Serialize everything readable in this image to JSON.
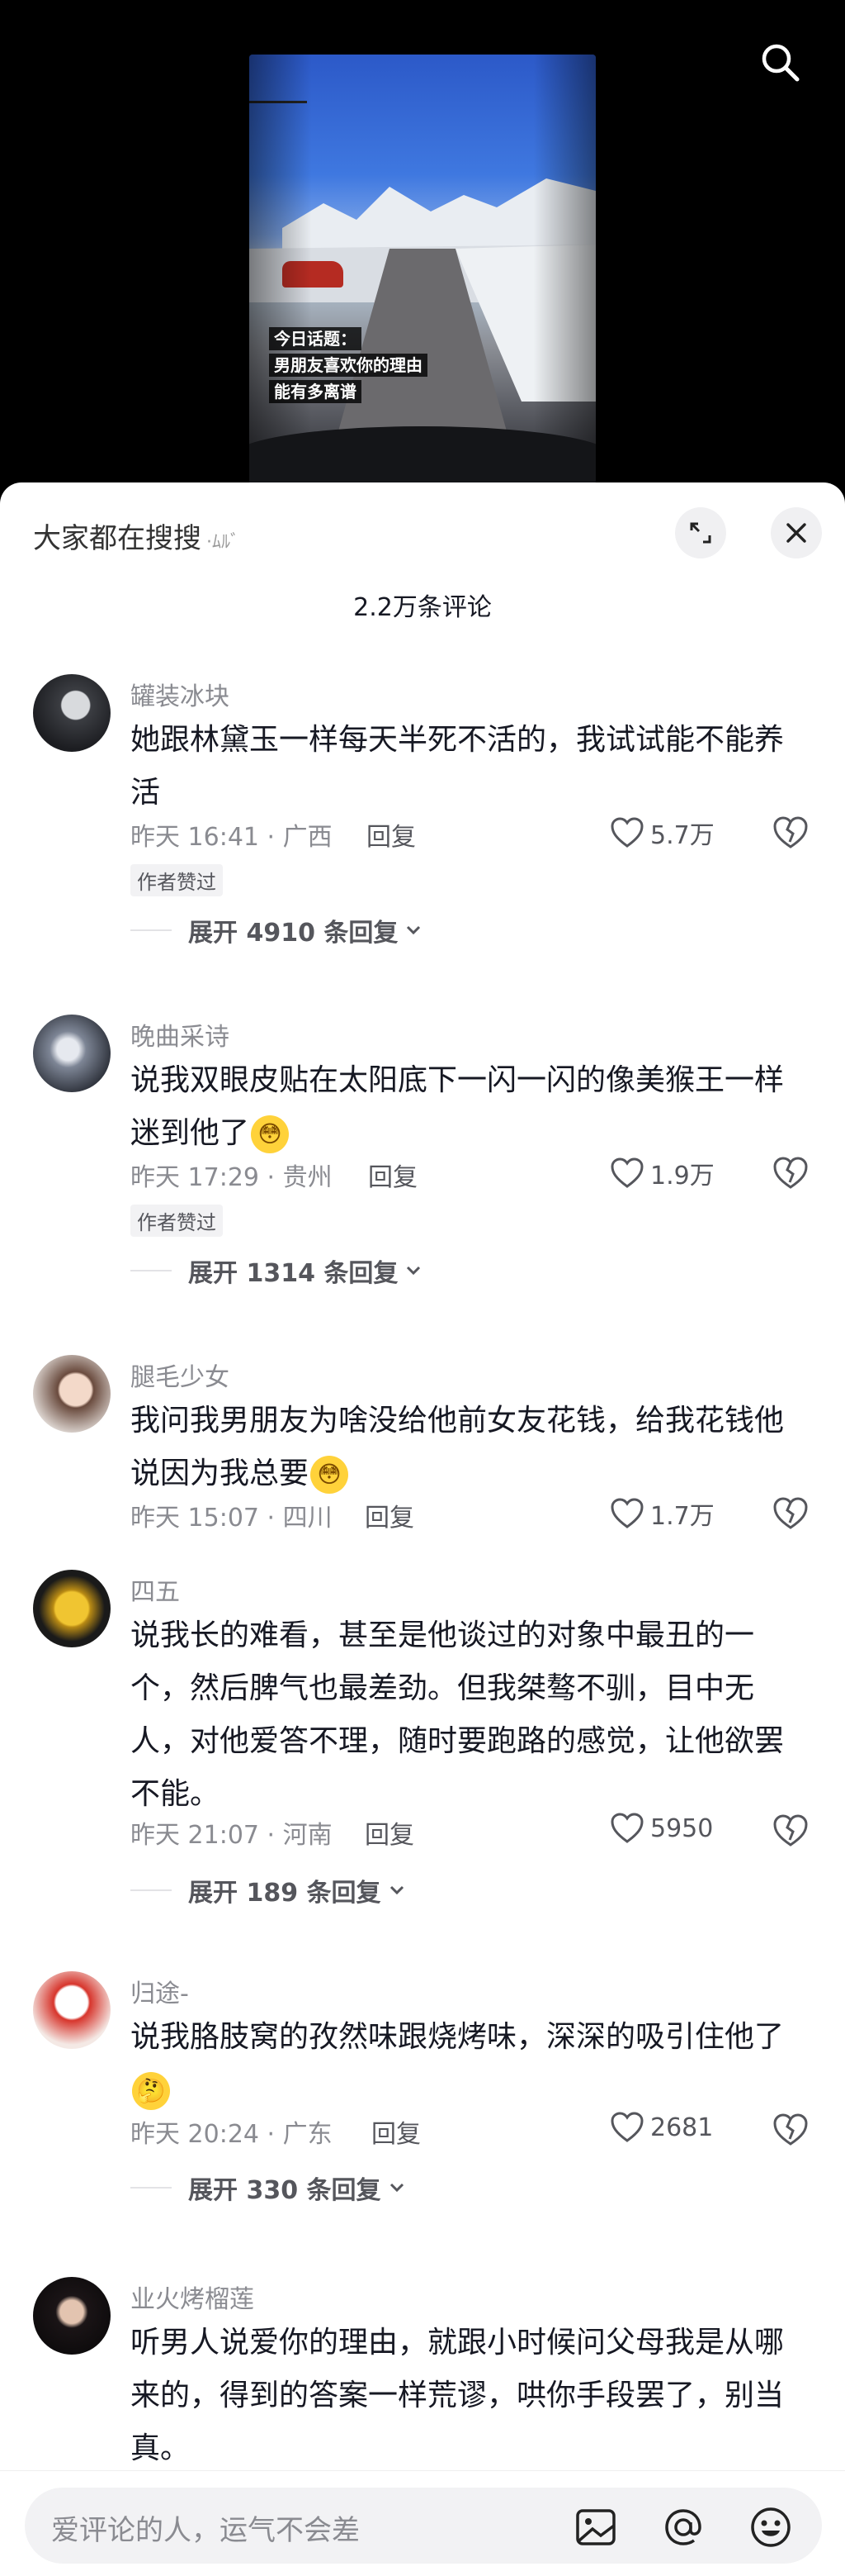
{
  "video": {
    "topic_lines": [
      "今日话题：",
      "男朋友喜欢你的理由",
      "能有多离谱"
    ]
  },
  "sheet": {
    "title": "大家都在搜搜",
    "title_suffix": "·ﾑﾙﾞ",
    "comment_count": "2.2万条评论"
  },
  "comments": [
    {
      "username": "罐装冰块",
      "text": "她跟林黛玉一样每天半死不活的，我试试能不能养活",
      "time_location": "昨天 16:41 · 广西",
      "reply_label": "回复",
      "likes": "5.7万",
      "author_tag": "作者赞过",
      "expand_label": "展开 4910 条回复"
    },
    {
      "username": "晚曲采诗",
      "text": "说我双眼皮贴在太阳底下一闪一闪的像美猴王一样迷到他了",
      "emoji": "😳",
      "time_location": "昨天 17:29 · 贵州",
      "reply_label": "回复",
      "likes": "1.9万",
      "author_tag": "作者赞过",
      "expand_label": "展开 1314 条回复"
    },
    {
      "username": "腿毛少女",
      "text": "我问我男朋友为啥没给他前女友花钱，给我花钱他说因为我总要",
      "emoji": "😳",
      "time_location": "昨天 15:07 · 四川",
      "reply_label": "回复",
      "likes": "1.7万"
    },
    {
      "username": "四五",
      "text": "说我长的难看，甚至是他谈过的对象中最丑的一个，然后脾气也最差劲。但我桀骜不驯，目中无人，对他爱答不理，随时要跑路的感觉，让他欲罢不能。",
      "time_location": "昨天 21:07 · 河南",
      "reply_label": "回复",
      "likes": "5950",
      "expand_label": "展开 189 条回复"
    },
    {
      "username": "归途-",
      "text": "说我胳肢窝的孜然味跟烧烤味，深深的吸引住他了",
      "emoji": "🤔",
      "time_location": "昨天 20:24 · 广东",
      "reply_label": "回复",
      "likes": "2681",
      "expand_label": "展开 330 条回复"
    },
    {
      "username": "业火烤榴莲",
      "text": "听男人说爱你的理由，就跟小时候问父母我是从哪来的，得到的答案一样荒谬，哄你手段罢了，别当真。"
    }
  ],
  "bottom": {
    "placeholder": "爱评论的人，运气不会差"
  },
  "colors": {
    "accent_text": "#161823",
    "muted": "#8a8b91",
    "input_bg": "#f2f2f4"
  }
}
